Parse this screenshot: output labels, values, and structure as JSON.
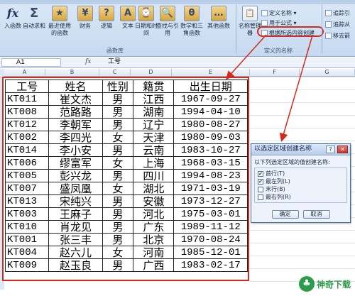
{
  "ribbon": {
    "buttons": [
      {
        "label": "入函数",
        "icon": "fx"
      },
      {
        "label": "自动求和",
        "icon": "Σ"
      },
      {
        "label": "最近使用的函数",
        "icon": "★"
      },
      {
        "label": "财务",
        "icon": "¥"
      },
      {
        "label": "逻辑",
        "icon": "?"
      },
      {
        "label": "文本",
        "icon": "A"
      },
      {
        "label": "日期和时间",
        "icon": "⌚"
      },
      {
        "label": "查找与引用",
        "icon": "🔍"
      },
      {
        "label": "数学和三角函数",
        "icon": "θ"
      },
      {
        "label": "其他函数",
        "icon": "…"
      },
      {
        "label": "名称管理器",
        "icon": "📋"
      }
    ],
    "group_function_library": "函数库",
    "defined_names": [
      {
        "label": "定义名称 ▾"
      },
      {
        "label": "用于公式 ▾"
      },
      {
        "label": "根据所选内容创建"
      }
    ],
    "group_defined_names": "定义的名称",
    "trace_cmds": [
      "追踪引",
      "追踪从",
      "移去箭"
    ]
  },
  "formula_bar": {
    "name_box": "A1",
    "fx": "fx",
    "content": "工号"
  },
  "columns": [
    "A",
    "B",
    "C",
    "D",
    "E",
    "F",
    "G"
  ],
  "table": {
    "headers": [
      "工号",
      "姓名",
      "性别",
      "籍贯",
      "出生日期"
    ],
    "rows": [
      [
        "KT011",
        "崔文杰",
        "男",
        "江西",
        "1967-09-27"
      ],
      [
        "KT008",
        "范路路",
        "男",
        "湖南",
        "1994-04-10"
      ],
      [
        "KT012",
        "李朝军",
        "男",
        "辽宁",
        "1980-08-27"
      ],
      [
        "KT002",
        "李四光",
        "女",
        "天津",
        "1980-09-03"
      ],
      [
        "KT014",
        "李小安",
        "男",
        "云南",
        "1983-10-27"
      ],
      [
        "KT006",
        "缪富军",
        "女",
        "上海",
        "1968-03-15"
      ],
      [
        "KT005",
        "彭兴龙",
        "男",
        "四川",
        "1994-08-23"
      ],
      [
        "KT007",
        "盛凤凰",
        "女",
        "湖北",
        "1971-03-19"
      ],
      [
        "KT013",
        "宋纯兴",
        "男",
        "安徽",
        "1973-12-27"
      ],
      [
        "KT003",
        "王麻子",
        "男",
        "河北",
        "1975-03-01"
      ],
      [
        "KT010",
        "肖龙见",
        "男",
        "广东",
        "1989-11-12"
      ],
      [
        "KT001",
        "张三丰",
        "男",
        "北京",
        "1970-08-24"
      ],
      [
        "KT004",
        "赵六儿",
        "女",
        "河南",
        "1985-12-01"
      ],
      [
        "KT009",
        "赵玉良",
        "男",
        "广西",
        "1983-02-17"
      ]
    ]
  },
  "dialog": {
    "title": "以选定区域创建名称",
    "help": "?",
    "close": "✕",
    "group_label": "以下列选定区域的值创建名称:",
    "options": [
      {
        "label": "首行(T)",
        "checked": "✔"
      },
      {
        "label": "最左列(L)",
        "checked": "✔"
      },
      {
        "label": "末行(B)",
        "checked": ""
      },
      {
        "label": "最右列(R)",
        "checked": ""
      }
    ],
    "ok": "确定",
    "cancel": "取消"
  },
  "watermark": {
    "logo": "♣",
    "text": "神奇下载"
  },
  "colors": {
    "highlight": "#d42a1c",
    "ribbon": "#c6d9f0"
  }
}
